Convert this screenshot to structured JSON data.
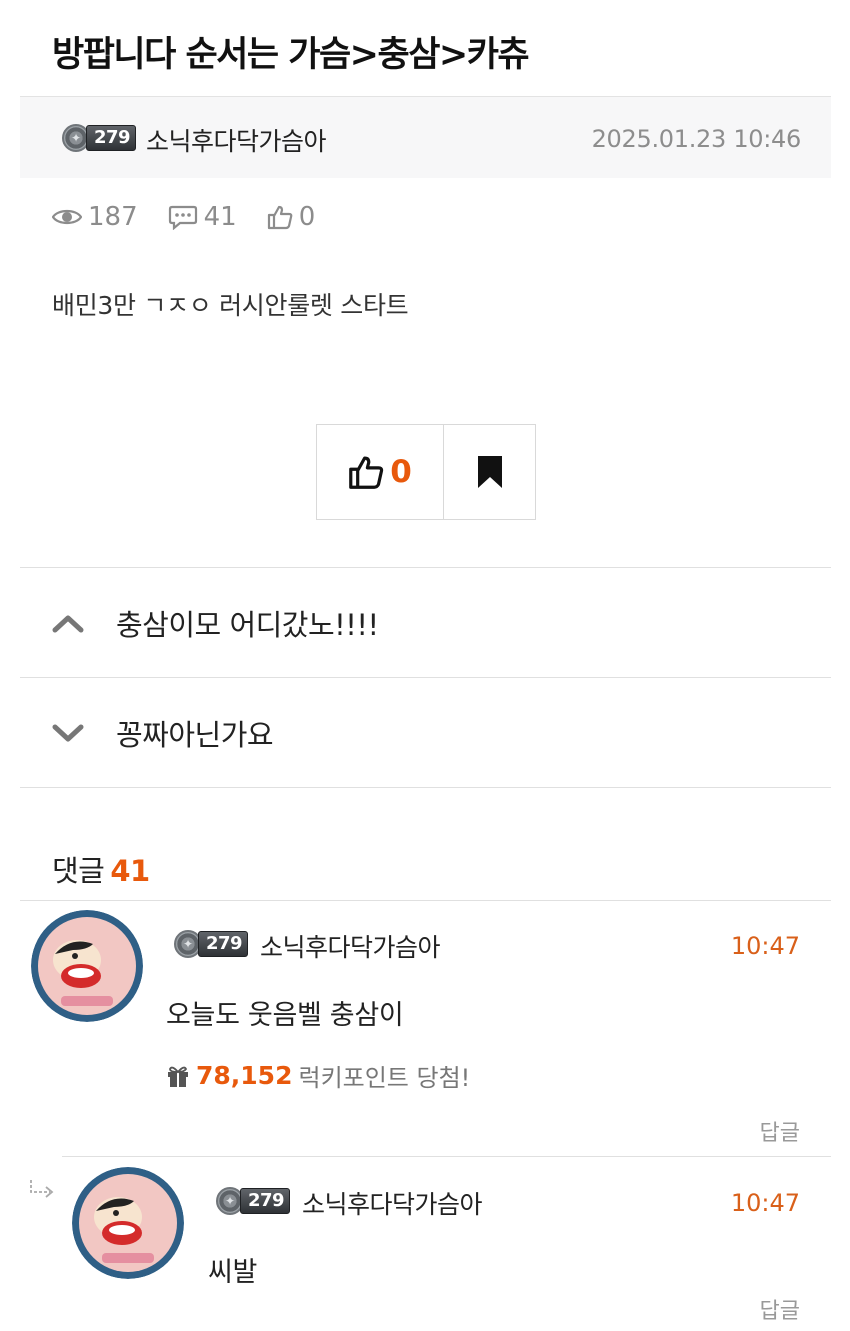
{
  "post": {
    "title": "방팝니다 순서는 가슴>충삼>카츄",
    "author": {
      "level": "279",
      "name": "소닉후다닥가슴아"
    },
    "date": "2025.01.23 10:46",
    "stats": {
      "views": "187",
      "comments": "41",
      "likes": "0"
    },
    "body": "배민3만 ㄱㅈㅇ 러시안룰렛 스타트"
  },
  "actions": {
    "like_count": "0"
  },
  "nav": {
    "prev": {
      "icon": "chevron-up-icon",
      "title": "충삼이모 어디갔노!!!!"
    },
    "next": {
      "icon": "chevron-down-icon",
      "title": "꽁짜아닌가요"
    }
  },
  "comments_section": {
    "label": "댓글",
    "count": "41"
  },
  "comments": [
    {
      "author": {
        "level": "279",
        "name": "소닉후다닥가슴아"
      },
      "time": "10:47",
      "text": "오늘도 웃음벨 충삼이",
      "lucky": {
        "points": "78,152",
        "label": "럭키포인트 당첨!"
      },
      "reply_label": "답글"
    },
    {
      "author": {
        "level": "279",
        "name": "소닉후다닥가슴아"
      },
      "time": "10:47",
      "text": "씨발",
      "reply_label": "답글"
    }
  ],
  "colors": {
    "accent": "#e8590c",
    "time": "#d9601a",
    "muted": "#8c8c8c",
    "divider": "#e0e0e0"
  }
}
